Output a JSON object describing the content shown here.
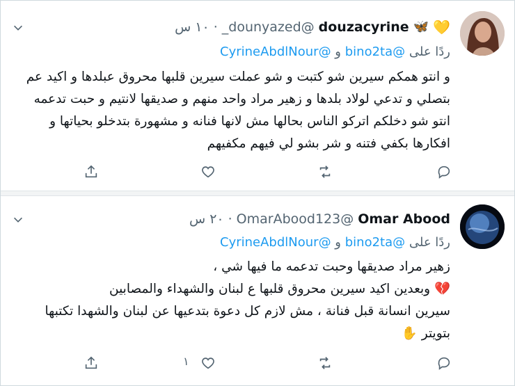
{
  "tweets": [
    {
      "display_name": "douzacyrine",
      "emoji": "butterfly-heart",
      "handle": "@dounyazed_",
      "dot": "·",
      "time": "١٠ س",
      "reply_prefix": "ردًا على",
      "reply_mentions": [
        "@bino2ta",
        "و",
        "@CyrineAbdlNour"
      ],
      "lines": [
        "و انتو همكم سيرين شو كتبت و شو عملت سيرين قلبها محروق عبلدها و اكيد عم",
        "بتصلي و تدعي  لولاد بلدها و زهير مراد واحد منهم و صديقها لانتيم و حبت تدعمه",
        "انتو شو دخلكم اتركو الناس بحالها مش لانها فنانه و مشهورة بتدخلو بحياتها و",
        "افكارها بكفي فتنه و شر  بشو لي فيهم مكفيهم"
      ],
      "like_count": ""
    },
    {
      "display_name": "Omar Abood",
      "handle": "@OmarAbood123",
      "dot": "·",
      "time": "٢٠ س",
      "reply_prefix": "ردًا على",
      "reply_mentions": [
        "@bino2ta",
        "و",
        "@CyrineAbdlNour"
      ],
      "lines": [
        "زهير مراد صديقها وحبت تدعمه ما فيها شي ،",
        "وبعدين اكيد سيرين محروق قلبها ع لبنان والشهداء والمصابين",
        "سيرين انسانة قبل فنانة ، مش لازم كل دعوة بتدعيها عن لبنان والشهدا تكتبها",
        "بتويتر"
      ],
      "like_count": "١"
    }
  ],
  "icons": {
    "more": "chevron-down-icon",
    "reply": "reply-icon",
    "retweet": "retweet-icon",
    "like": "heart-icon",
    "share": "share-icon"
  },
  "colors": {
    "link": "#1d9bf0",
    "secondary_text": "#536471",
    "broken_heart": "#e0245e",
    "hand": "#f5c542"
  }
}
